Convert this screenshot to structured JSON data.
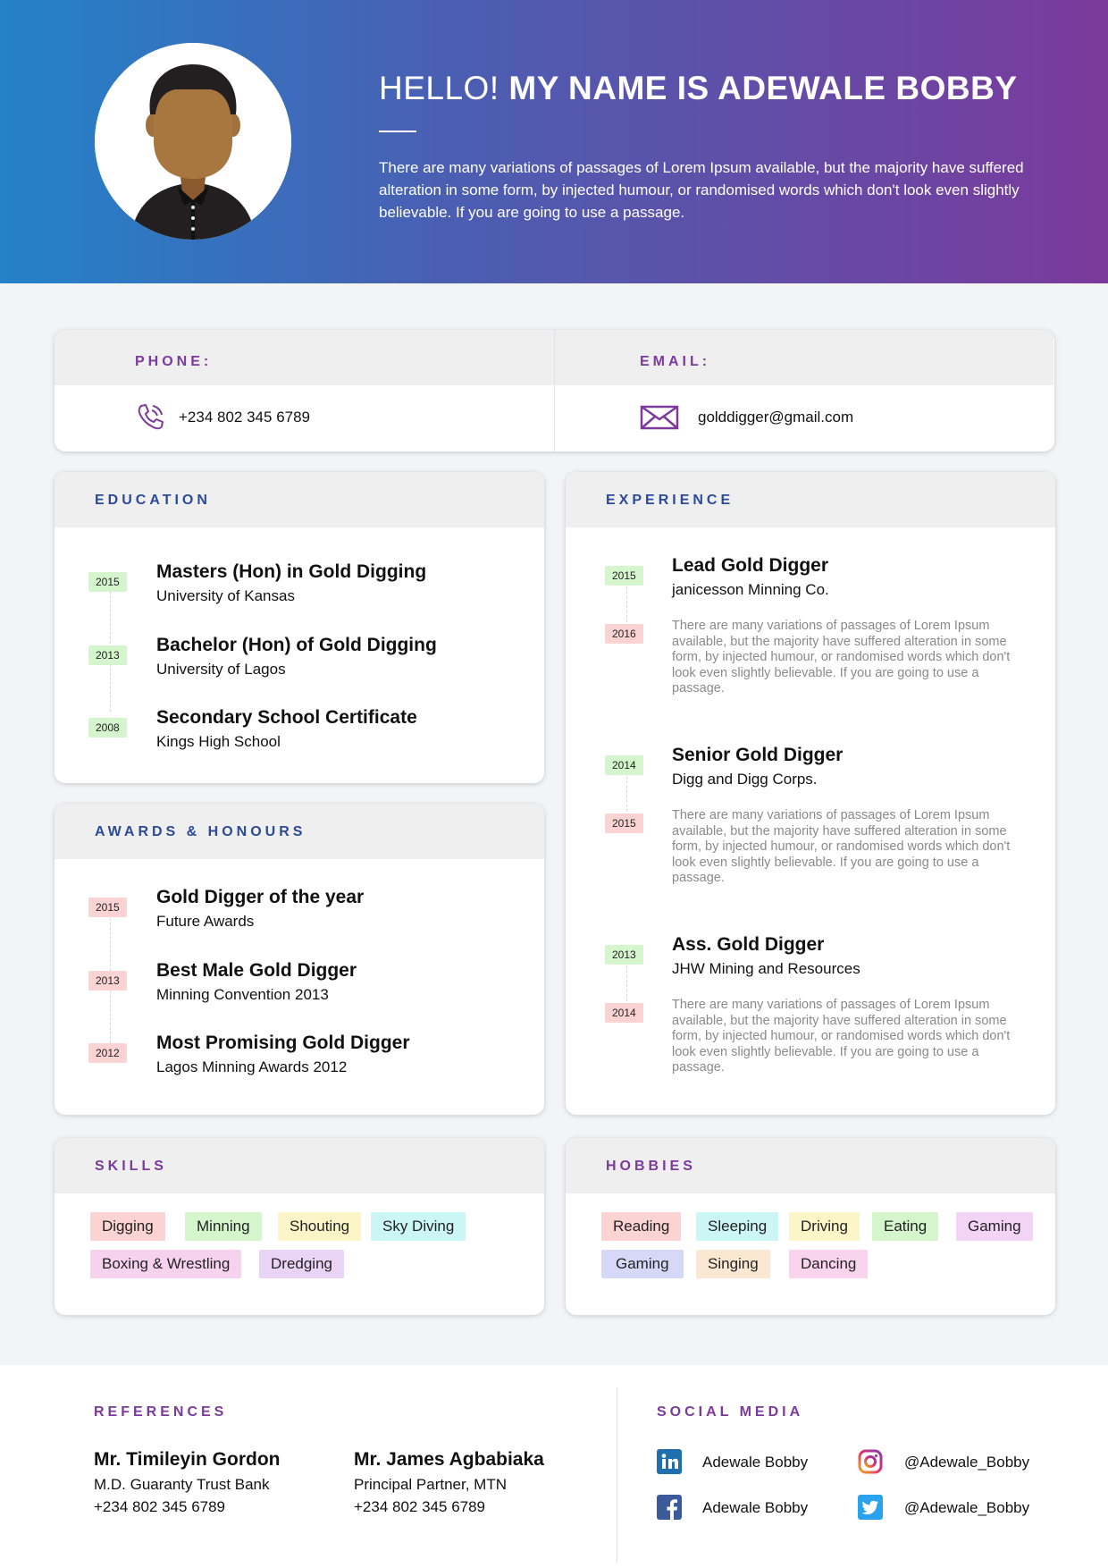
{
  "header": {
    "greeting": "HELLO!",
    "name_line": "MY NAME IS ADEWALE BOBBY",
    "intro": "There are many variations of passages of Lorem Ipsum available, but the majority  have suffered alteration in some form, by injected humour, or randomised words  which don't look even slightly believable. If you are going to use a passage."
  },
  "contact": {
    "phone_label": "PHONE:",
    "phone": "+234 802 345 6789",
    "email_label": "EMAIL:",
    "email": "golddigger@gmail.com"
  },
  "education": {
    "title": "EDUCATION",
    "items": [
      {
        "year": "2015",
        "title": "Masters (Hon) in Gold Digging",
        "sub": "University of Kansas"
      },
      {
        "year": "2013",
        "title": "Bachelor (Hon) of Gold Digging",
        "sub": "University of Lagos"
      },
      {
        "year": "2008",
        "title": "Secondary School Certificate",
        "sub": "Kings High School"
      }
    ]
  },
  "awards": {
    "title": "AWARDS & HONOURS",
    "items": [
      {
        "year": "2015",
        "title": "Gold Digger of the year",
        "sub": "Future Awards"
      },
      {
        "year": "2013",
        "title": "Best Male Gold Digger",
        "sub": "Minning Convention 2013"
      },
      {
        "year": "2012",
        "title": "Most Promising Gold Digger",
        "sub": "Lagos Minning Awards 2012"
      }
    ]
  },
  "experience": {
    "title": "EXPERIENCE",
    "items": [
      {
        "start": "2015",
        "end": "2016",
        "title": "Lead Gold Digger",
        "company": "janicesson Minning Co.",
        "desc": "There are many variations of passages of Lorem Ipsum available, but the majority  have suffered alteration in some form, by injected humour, or randomised words which don't look even slightly believable. If you are going to use a passage."
      },
      {
        "start": "2014",
        "end": "2015",
        "title": "Senior Gold Digger",
        "company": "Digg and Digg Corps.",
        "desc": "There are many variations of passages of Lorem Ipsum available, but the majority  have suffered alteration in some form, by injected humour, or randomised words which don't look even slightly believable. If you are going to use a passage."
      },
      {
        "start": "2013",
        "end": "2014",
        "title": "Ass. Gold Digger",
        "company": "JHW Mining and Resources",
        "desc": "There are many variations of passages of Lorem Ipsum available, but the majority  have suffered alteration in some form, by injected humour, or randomised words which don't look even slightly believable. If you are going to use a passage."
      }
    ]
  },
  "skills": {
    "title": "SKILLS",
    "tags": [
      "Digging",
      "Minning",
      "Shouting",
      "Sky Diving",
      "Boxing & Wrestling",
      "Dredging"
    ]
  },
  "hobbies": {
    "title": "HOBBIES",
    "tags": [
      "Reading",
      "Sleeping",
      "Driving",
      "Eating",
      "Gaming",
      "Gaming",
      "Singing",
      "Dancing"
    ]
  },
  "references": {
    "title": "REFERENCES",
    "people": [
      {
        "name": "Mr. Timileyin Gordon",
        "role": "M.D. Guaranty Trust Bank",
        "phone": "+234 802 345 6789"
      },
      {
        "name": "Mr. James Agbabiaka",
        "role": "Principal Partner, MTN",
        "phone": "+234 802 345 6789"
      }
    ]
  },
  "social": {
    "title": "SOCIAL MEDIA",
    "linkedin": "Adewale Bobby",
    "instagram": "@Adewale_Bobby",
    "facebook": "Adewale Bobby",
    "twitter": "@Adewale_Bobby"
  },
  "colors": {
    "accent_purple": "#7b3a9c",
    "accent_blue": "#2b4a9a",
    "gradient_start": "#2382c9",
    "gradient_end": "#7b3a9c",
    "badge_green": "#d5f5cc",
    "badge_red": "#fbd3d3"
  }
}
